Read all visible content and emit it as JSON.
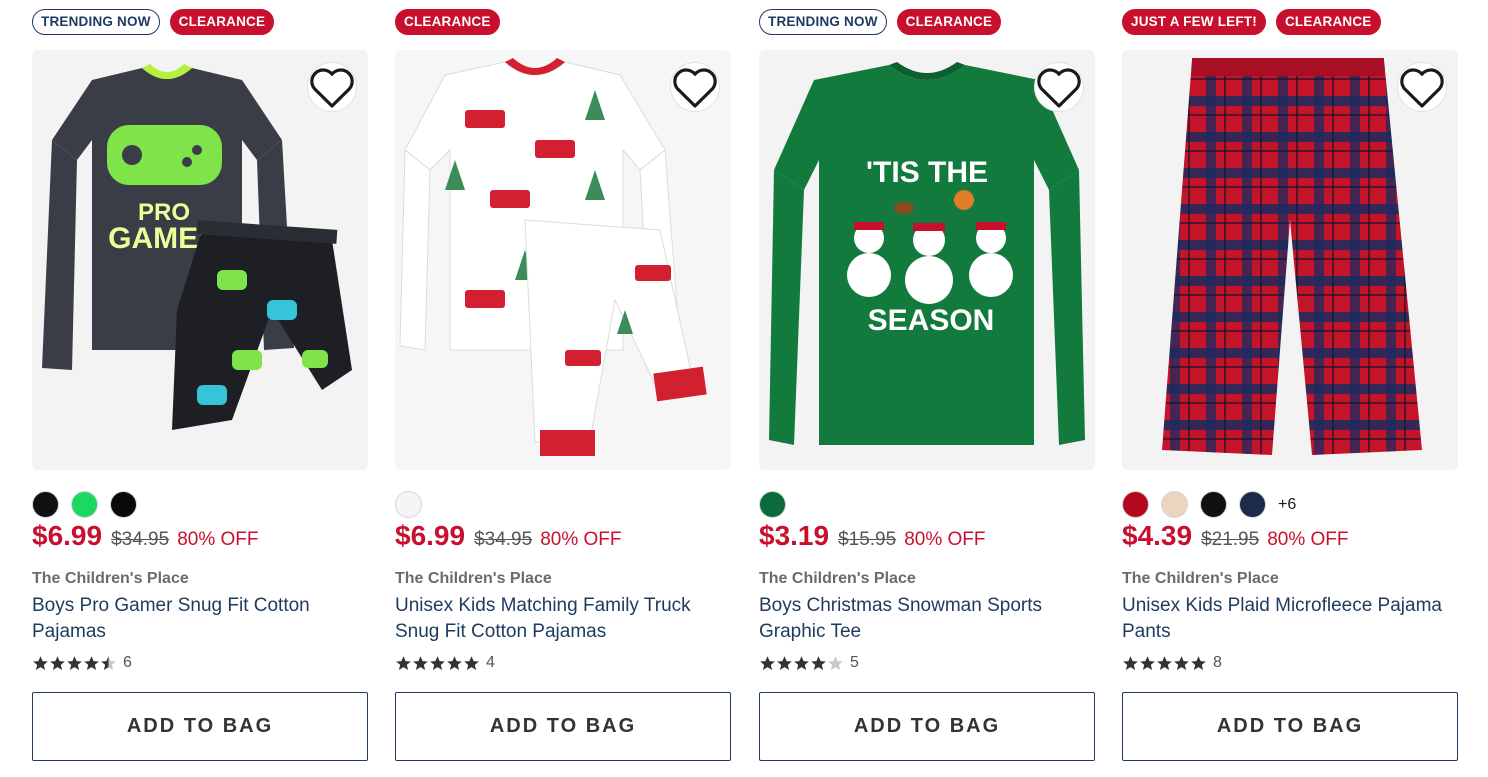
{
  "products": [
    {
      "badges": [
        {
          "text": "TRENDING NOW",
          "style": "outline"
        },
        {
          "text": "CLEARANCE",
          "style": "red"
        }
      ],
      "image": "boys-pro-gamer-pajamas",
      "swatches": [
        "#111111",
        "#1ed760",
        "#0a0a0a"
      ],
      "more_colors": "",
      "sale_price": "$6.99",
      "list_price": "$34.95",
      "discount": "80% OFF",
      "brand": "The Children's Place",
      "title": "Boys Pro Gamer Snug Fit Cotton Pajamas",
      "rating": 4.5,
      "review_count": "6",
      "add_label": "ADD TO BAG"
    },
    {
      "badges": [
        {
          "text": "CLEARANCE",
          "style": "red"
        }
      ],
      "image": "unisex-truck-pajamas",
      "swatches": [
        "#f5f5f5"
      ],
      "more_colors": "",
      "sale_price": "$6.99",
      "list_price": "$34.95",
      "discount": "80% OFF",
      "brand": "The Children's Place",
      "title": "Unisex Kids Matching Family Truck Snug Fit Cotton Pajamas",
      "rating": 5,
      "review_count": "4",
      "add_label": "ADD TO BAG"
    },
    {
      "badges": [
        {
          "text": "TRENDING NOW",
          "style": "outline"
        },
        {
          "text": "CLEARANCE",
          "style": "red"
        }
      ],
      "image": "boys-snowman-tee",
      "swatches": [
        "#0b6b3a"
      ],
      "more_colors": "",
      "sale_price": "$3.19",
      "list_price": "$15.95",
      "discount": "80% OFF",
      "brand": "The Children's Place",
      "title": "Boys Christmas Snowman Sports Graphic Tee",
      "rating": 4,
      "review_count": "5",
      "add_label": "ADD TO BAG"
    },
    {
      "badges": [
        {
          "text": "JUST A FEW LEFT!",
          "style": "red"
        },
        {
          "text": "CLEARANCE",
          "style": "red"
        }
      ],
      "image": "unisex-plaid-pants",
      "swatches": [
        "#b3091f",
        "#ead6c0",
        "#111111",
        "#1e2a4a"
      ],
      "more_colors": "+6",
      "sale_price": "$4.39",
      "list_price": "$21.95",
      "discount": "80% OFF",
      "brand": "The Children's Place",
      "title": "Unisex Kids Plaid Microfleece Pajama Pants",
      "rating": 5,
      "review_count": "8",
      "add_label": "ADD TO BAG"
    }
  ],
  "product_art": {
    "p0": {
      "lines": [
        "PRO",
        "GAMER"
      ]
    },
    "p2": {
      "lines": [
        "'TIS THE",
        "SEASON"
      ]
    }
  },
  "colors": {
    "sale_red": "#c8102e",
    "navy": "#1e3a5f"
  }
}
